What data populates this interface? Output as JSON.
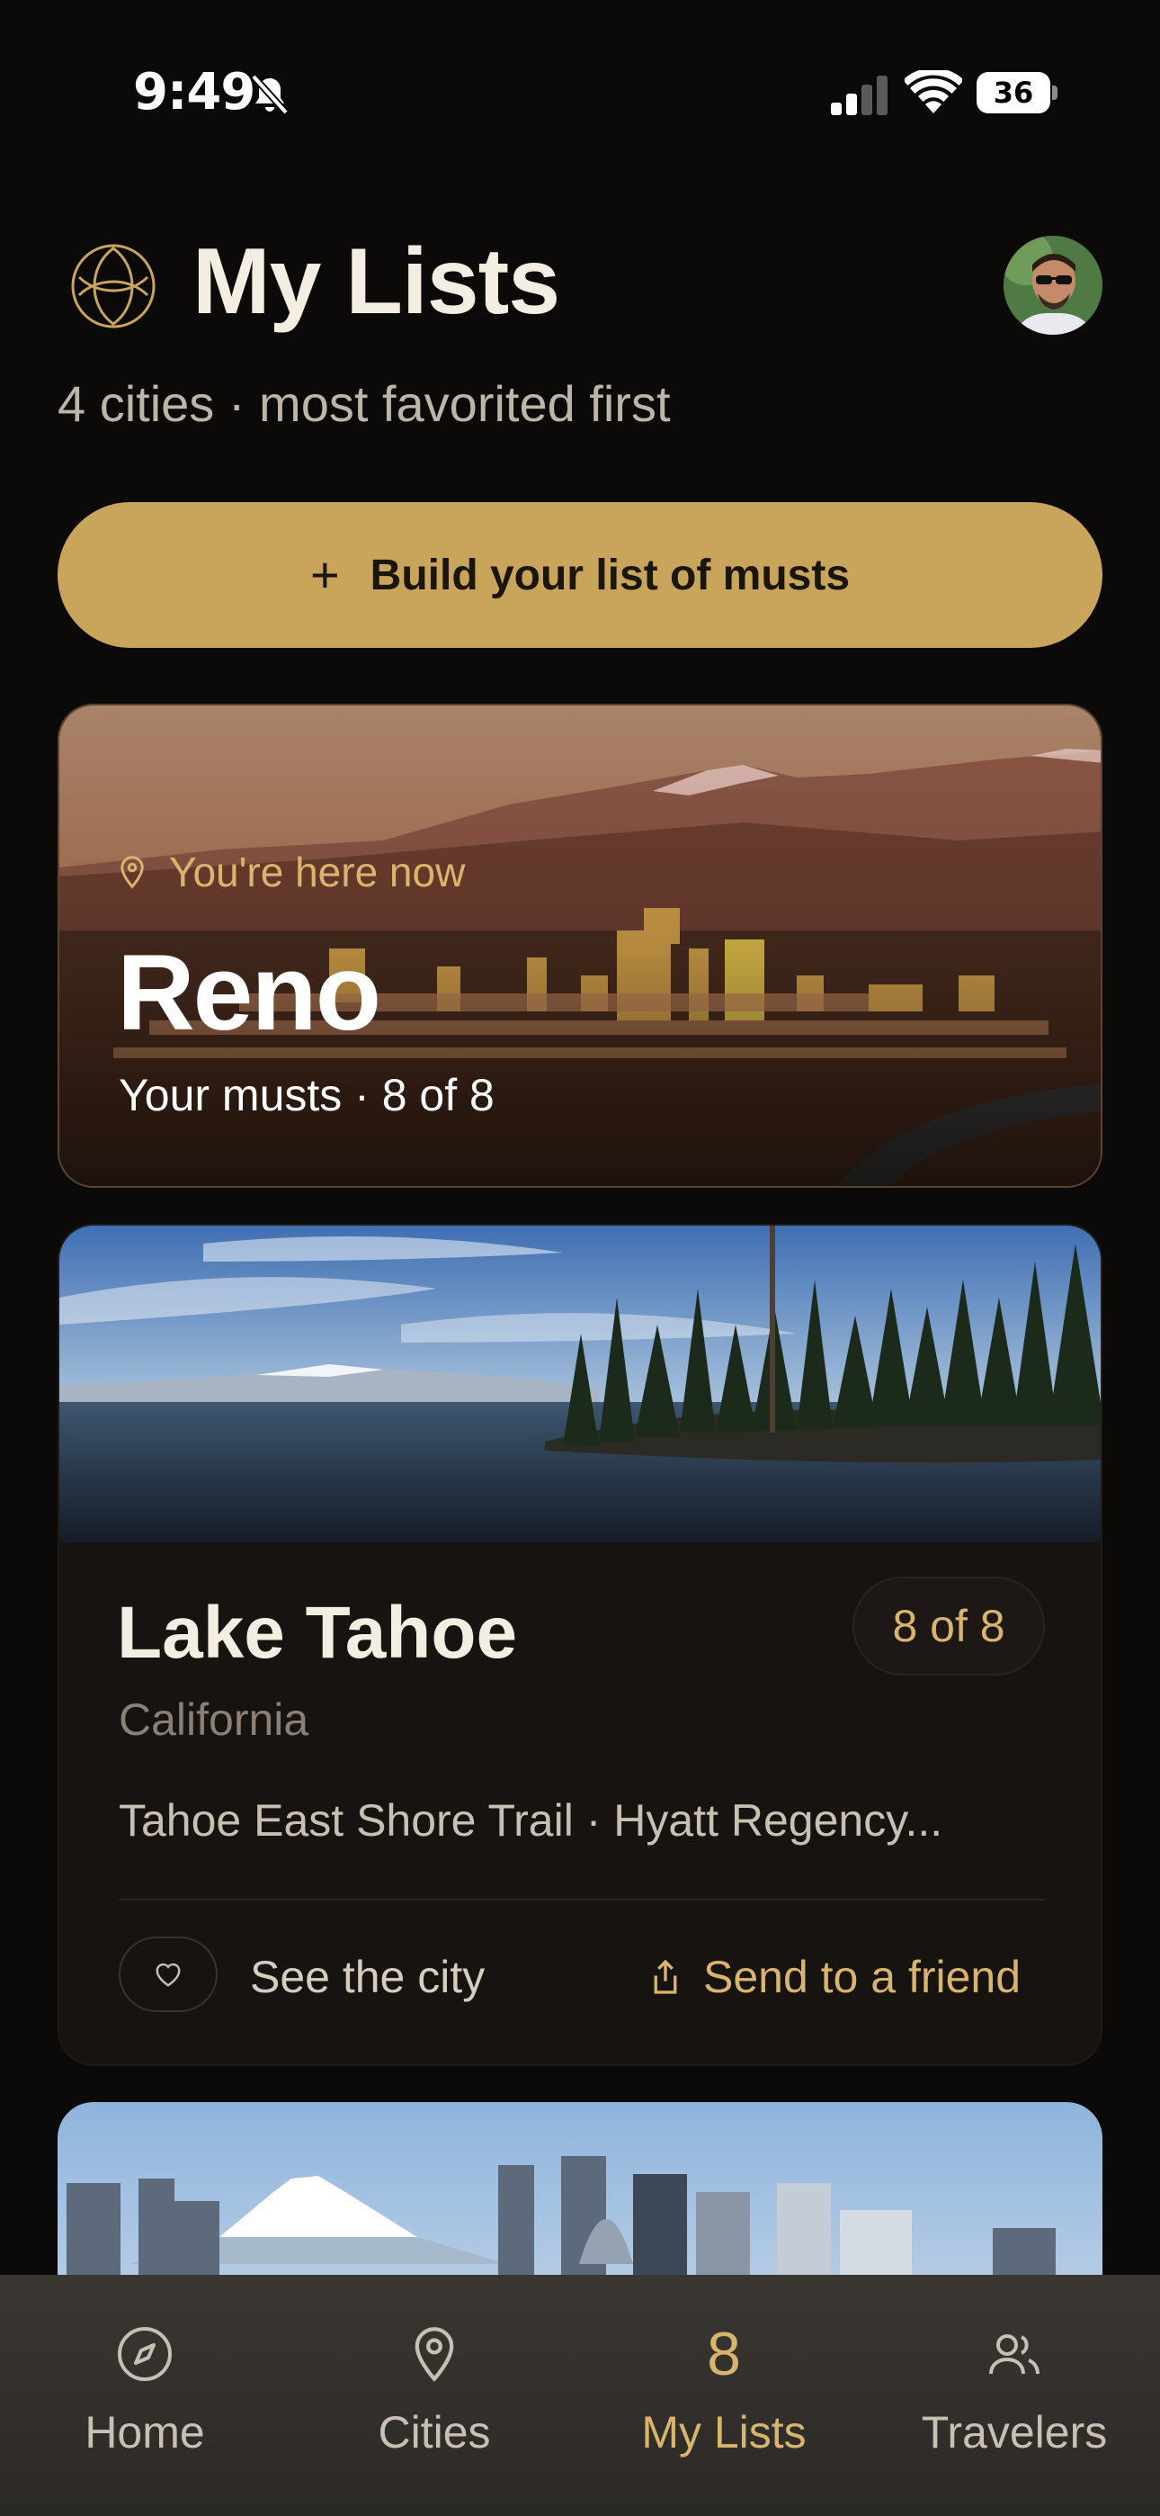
{
  "status": {
    "time": "9:49",
    "battery": "36"
  },
  "header": {
    "title": "My Lists",
    "subtitle": "4 cities · most favorited first"
  },
  "cta": {
    "label": "Build your list of musts",
    "plus": "+"
  },
  "reno": {
    "location_note": "You're here now",
    "name": "Reno",
    "musts": "Your musts · 8 of 8"
  },
  "tahoe": {
    "name": "Lake Tahoe",
    "count": "8 of 8",
    "state": "California",
    "places": "Tahoe East Shore Trail · Hyatt Regency...",
    "see_city": "See the city",
    "send_friend": "Send to a friend"
  },
  "tabs": {
    "home": "Home",
    "cities": "Cities",
    "my_lists": "My Lists",
    "my_lists_count": "8",
    "travelers": "Travelers"
  },
  "colors": {
    "accent": "#c9a55c",
    "gold_text": "#d9b46c",
    "background": "#0b0a09",
    "card": "#171311"
  }
}
